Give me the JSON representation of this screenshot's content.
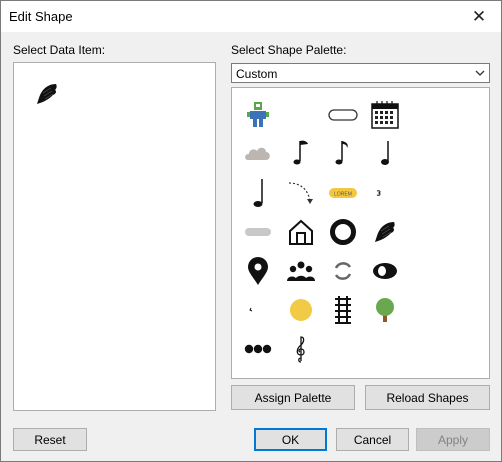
{
  "window": {
    "title": "Edit Shape",
    "close_glyph": "✕"
  },
  "left": {
    "label": "Select Data Item:"
  },
  "right": {
    "label": "Select Shape Palette:",
    "palette_select": {
      "value": "Custom"
    }
  },
  "buttons": {
    "assign_palette": "Assign Palette",
    "reload_shapes": "Reload Shapes",
    "reset": "Reset",
    "ok": "OK",
    "cancel": "Cancel",
    "apply": "Apply"
  },
  "palette_badge_text": "LOREM",
  "colors": {
    "focus_border": "#0078d7",
    "robot_green": "#5aa64a",
    "robot_blue": "#3c72b8",
    "cloud_gray": "#bdb5b0",
    "badge_yellow": "#f4c740",
    "circle_yellow": "#f1cb45",
    "tree_green": "#6aa84f",
    "tree_trunk": "#8a5a2b"
  }
}
